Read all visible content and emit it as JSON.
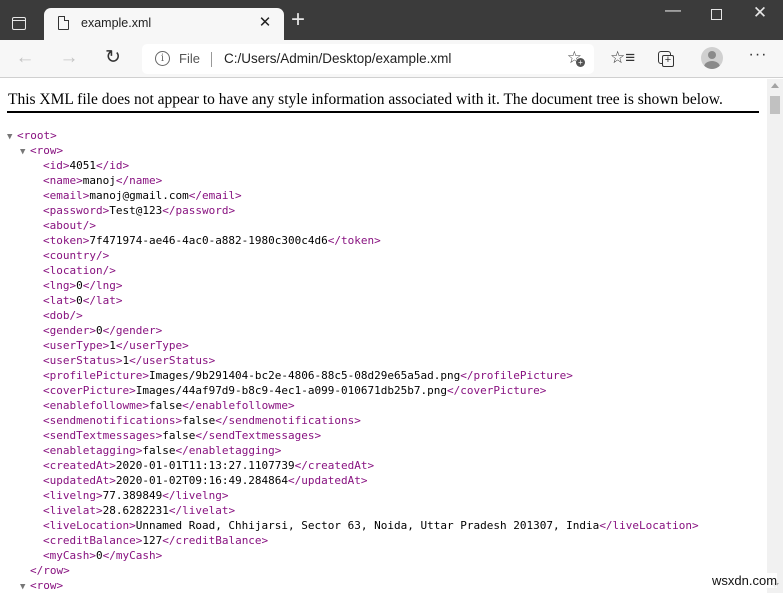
{
  "browser": {
    "tab": {
      "title": "example.xml",
      "close": "✕"
    },
    "new_tab": "+",
    "window": {
      "minimize": "—",
      "close": "✕"
    },
    "toolbar": {
      "back": "←",
      "forward": "→",
      "reload": "↻",
      "info": "i",
      "scheme": "File",
      "url": "C:/Users/Admin/Desktop/example.xml",
      "favorite_add": "☆",
      "favorites": "☆≡",
      "more": "···"
    }
  },
  "page": {
    "notice": "This XML file does not appear to have any style information associated with it. The document tree is shown below.",
    "toggle": "▼",
    "root_open": "<root>",
    "row_open": "<row>",
    "row_close": "</row>",
    "fields": [
      {
        "name": "id",
        "value": "4051"
      },
      {
        "name": "name",
        "value": "manoj"
      },
      {
        "name": "email",
        "value": "manoj@gmail.com"
      },
      {
        "name": "password",
        "value": "Test@123"
      },
      {
        "name": "about",
        "empty": true
      },
      {
        "name": "token",
        "value": "7f471974-ae46-4ac0-a882-1980c300c4d6"
      },
      {
        "name": "country",
        "empty": true
      },
      {
        "name": "location",
        "empty": true
      },
      {
        "name": "lng",
        "value": "0"
      },
      {
        "name": "lat",
        "value": "0"
      },
      {
        "name": "dob",
        "empty": true
      },
      {
        "name": "gender",
        "value": "0"
      },
      {
        "name": "userType",
        "value": "1"
      },
      {
        "name": "userStatus",
        "value": "1"
      },
      {
        "name": "profilePicture",
        "value": "Images/9b291404-bc2e-4806-88c5-08d29e65a5ad.png"
      },
      {
        "name": "coverPicture",
        "value": "Images/44af97d9-b8c9-4ec1-a099-010671db25b7.png"
      },
      {
        "name": "enablefollowme",
        "value": "false"
      },
      {
        "name": "sendmenotifications",
        "value": "false"
      },
      {
        "name": "sendTextmessages",
        "value": "false"
      },
      {
        "name": "enabletagging",
        "value": "false"
      },
      {
        "name": "createdAt",
        "value": "2020-01-01T11:13:27.1107739"
      },
      {
        "name": "updatedAt",
        "value": "2020-01-02T09:16:49.284864"
      },
      {
        "name": "livelng",
        "value": "77.389849"
      },
      {
        "name": "livelat",
        "value": "28.6282231"
      },
      {
        "name": "liveLocation",
        "value": "Unnamed Road, Chhijarsi, Sector 63, Noida, Uttar Pradesh 201307, India"
      },
      {
        "name": "creditBalance",
        "value": "127"
      },
      {
        "name": "myCash",
        "value": "0"
      }
    ]
  },
  "watermark": "wsxdn.com"
}
